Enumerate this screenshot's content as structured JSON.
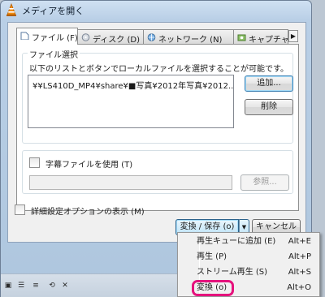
{
  "window": {
    "title": "メディアを開く"
  },
  "tabs": [
    {
      "label": "ファイル (F)",
      "active": true,
      "icon": "file-icon"
    },
    {
      "label": "ディスク (D)",
      "active": false,
      "icon": "disc-icon"
    },
    {
      "label": "ネットワーク (N)",
      "active": false,
      "icon": "network-icon"
    },
    {
      "label": "キャプチャーデ",
      "active": false,
      "icon": "capture-icon"
    }
  ],
  "file_selection": {
    "group_label": "ファイル選択",
    "hint": "以下のリストとボタンでローカルファイルを選択することが可能です。",
    "files": [
      "¥¥LS410D_MP4¥share¥■写真¥2012年写真¥2012..."
    ],
    "add_button": "追加...",
    "remove_button": "削除"
  },
  "subtitle": {
    "checkbox_label": "字幕ファイルを使用 (T)",
    "browse_button": "参照..."
  },
  "advanced_options_label": "詳細設定オプションの表示 (M)",
  "convert_save_button": "変換 / 保存 (o)",
  "cancel_button": "キャンセル (C)",
  "menu": [
    {
      "label": "再生キューに追加 (E)",
      "shortcut": "Alt+E"
    },
    {
      "label": "再生 (P)",
      "shortcut": "Alt+P"
    },
    {
      "label": "ストリーム再生 (S)",
      "shortcut": "Alt+S"
    },
    {
      "label": "変換 (o)",
      "shortcut": "Alt+O"
    }
  ],
  "colors": {
    "highlight": "#e5137d",
    "vlc_orange": "#f28c13"
  }
}
